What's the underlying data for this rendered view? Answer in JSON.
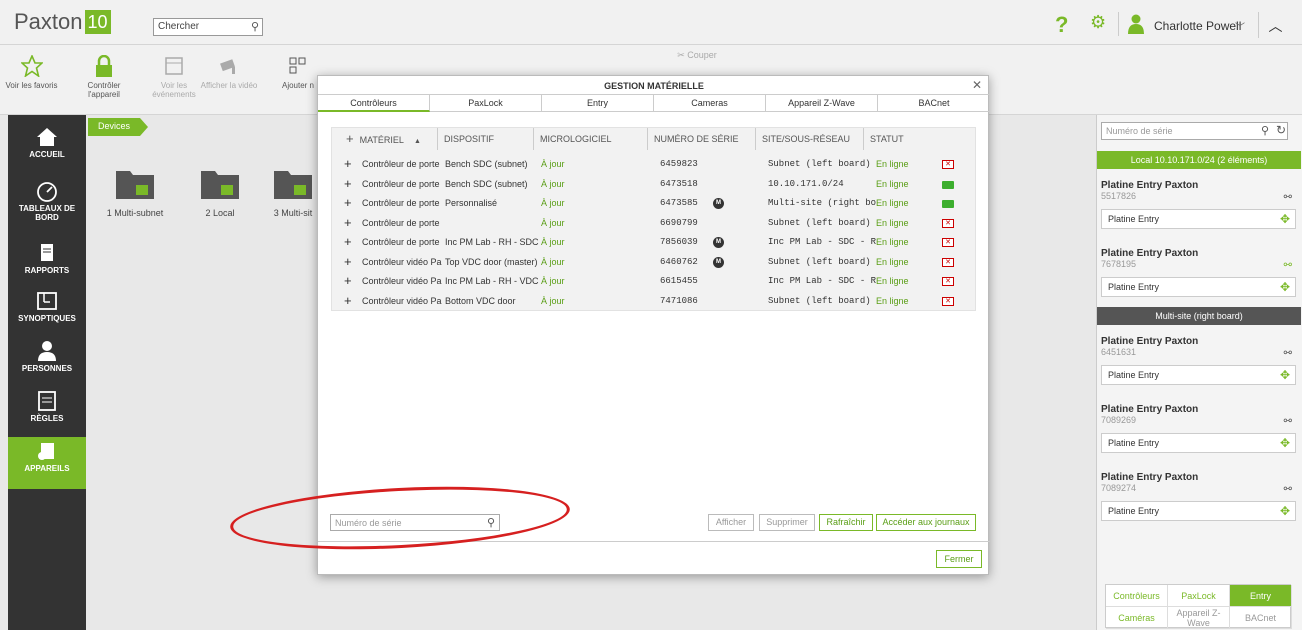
{
  "app": {
    "logo_text": "Paxton",
    "logo_num": "10",
    "search_placeholder": "Chercher",
    "user": "Charlotte Powell",
    "accent": "#7ab928"
  },
  "toolbar": [
    {
      "name": "favorites",
      "label": "Voir les favoris"
    },
    {
      "name": "control-device",
      "label": "Contrôler l'appareil"
    },
    {
      "name": "view-events",
      "label": "Voir les événements"
    },
    {
      "name": "show-video",
      "label": "Afficher la vidéo"
    },
    {
      "name": "add",
      "label": "Ajouter n"
    },
    {
      "name": "cut",
      "label": "Couper"
    }
  ],
  "sidebar": [
    {
      "icon": "home-icon",
      "label": "ACCUEIL"
    },
    {
      "icon": "dashboard-icon",
      "label": "TABLEAUX DE BORD"
    },
    {
      "icon": "reports-icon",
      "label": "RAPPORTS"
    },
    {
      "icon": "synoptics-icon",
      "label": "SYNOPTIQUES"
    },
    {
      "icon": "persons-icon",
      "label": "PERSONNES"
    },
    {
      "icon": "rules-icon",
      "label": "RÈGLES"
    },
    {
      "icon": "devices-icon",
      "label": "APPAREILS"
    }
  ],
  "breadcrumb": "Devices",
  "folders": [
    "1 Multi-subnet",
    "2 Local",
    "3 Multi-sit"
  ],
  "dialog": {
    "title": "GESTION MATÉRIELLE",
    "tabs": [
      "Contrôleurs",
      "PaxLock",
      "Entry",
      "Cameras",
      "Appareil Z-Wave",
      "BACnet"
    ],
    "columns": [
      "MATÉRIEL",
      "DISPOSITIF",
      "MICROLOGICIEL",
      "NUMÉRO DE SÉRIE",
      "SITE/SOUS-RÉSEAU",
      "STATUT"
    ],
    "rows": [
      {
        "type": "Contrôleur de porte",
        "device": "Bench SDC (subnet)",
        "fw": "À jour",
        "serial": "6459823",
        "m": false,
        "site": "Subnet (left board)",
        "status": "En ligne",
        "ok": false
      },
      {
        "type": "Contrôleur de porte",
        "device": "Bench SDC (subnet)",
        "fw": "À jour",
        "serial": "6473518",
        "m": false,
        "site": "10.10.171.0/24",
        "status": "En ligne",
        "ok": true
      },
      {
        "type": "Contrôleur de porte",
        "device": "Personnalisé",
        "fw": "À jour",
        "serial": "6473585",
        "m": true,
        "site": "Multi-site (right boa",
        "status": "En ligne",
        "ok": true
      },
      {
        "type": "Contrôleur de porte",
        "device": "",
        "fw": "À jour",
        "serial": "6690799",
        "m": false,
        "site": "Subnet (left board)",
        "status": "En ligne",
        "ok": false
      },
      {
        "type": "Contrôleur de porte",
        "device": "Inc PM Lab - RH - SDC",
        "fw": "À jour",
        "serial": "7856039",
        "m": true,
        "site": "Inc PM Lab - SDC - RH",
        "status": "En ligne",
        "ok": false
      },
      {
        "type": "Contrôleur vidéo Pa",
        "device": "Top VDC door (master)",
        "fw": "À jour",
        "serial": "6460762",
        "m": true,
        "site": "Subnet (left board)",
        "status": "En ligne",
        "ok": false
      },
      {
        "type": "Contrôleur vidéo Pa",
        "device": "Inc PM Lab - RH - VDC",
        "fw": "À jour",
        "serial": "6615455",
        "m": false,
        "site": "Inc PM Lab - SDC - RH",
        "status": "En ligne",
        "ok": false
      },
      {
        "type": "Contrôleur vidéo Pa",
        "device": "Bottom VDC door",
        "fw": "À jour",
        "serial": "7471086",
        "m": false,
        "site": "Subnet (left board)",
        "status": "En ligne",
        "ok": false
      }
    ],
    "search_placeholder": "Numéro de série",
    "buttons": [
      "Afficher",
      "Supprimer",
      "Rafraîchir",
      "Accéder aux journaux"
    ],
    "close": "Fermer"
  },
  "right_panel": {
    "search_placeholder": "Numéro de série",
    "groups": [
      "Local 10.10.171.0/24 (2 éléments)",
      "Multi-site (right board)"
    ],
    "cards": [
      {
        "title": "Platine Entry Paxton",
        "serial": "5517826",
        "row": "Platine Entry"
      },
      {
        "title": "Platine Entry Paxton",
        "serial": "7678195",
        "row": "Platine Entry"
      },
      {
        "title": "Platine Entry Paxton",
        "serial": "6451631",
        "row": "Platine Entry"
      },
      {
        "title": "Platine Entry Paxton",
        "serial": "7089269",
        "row": "Platine Entry"
      },
      {
        "title": "Platine Entry Paxton",
        "serial": "7089274",
        "row": "Platine Entry"
      }
    ],
    "tabs": [
      "Contrôleurs",
      "PaxLock",
      "Entry",
      "Caméras",
      "Appareil Z-Wave",
      "BACnet"
    ]
  }
}
